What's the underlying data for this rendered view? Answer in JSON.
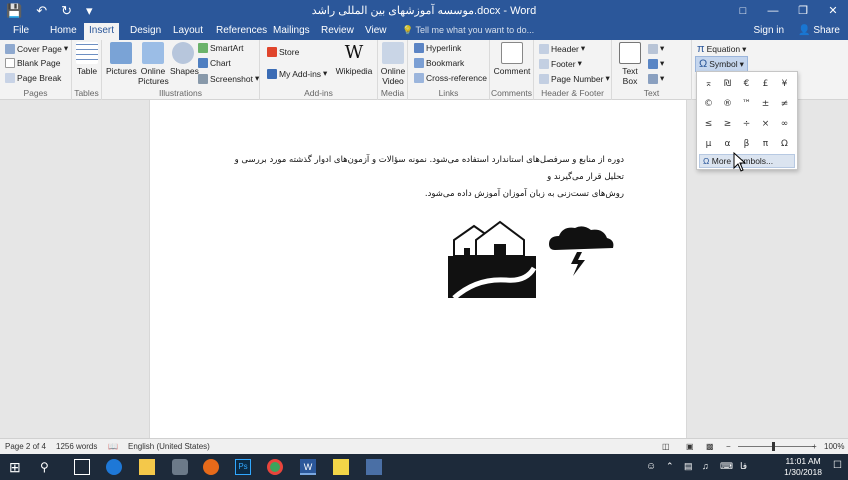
{
  "titlebar": {
    "title": "موسسه آموزشهای بین المللی راشد.docx - Word",
    "save_icon": "save-icon",
    "undo_icon": "undo-icon",
    "redo_icon": "redo-icon",
    "customize_icon": "customize-qat-icon"
  },
  "tabs": [
    "File",
    "Home",
    "Insert",
    "Design",
    "Layout",
    "References",
    "Mailings",
    "Review",
    "View"
  ],
  "tell_me": "Tell me what you want to do...",
  "account": {
    "signin": "Sign in",
    "share": "Share"
  },
  "ribbon": {
    "pages": {
      "label": "Pages",
      "cover": "Cover Page",
      "blank": "Blank Page",
      "break": "Page Break"
    },
    "tables": {
      "label": "Tables",
      "table": "Table"
    },
    "illustrations": {
      "label": "Illustrations",
      "pictures": "Pictures",
      "online_pictures": "Online Pictures",
      "shapes": "Shapes",
      "smartart": "SmartArt",
      "chart": "Chart",
      "screenshot": "Screenshot"
    },
    "addins": {
      "label": "Add-ins",
      "store": "Store",
      "my_addins": "My Add-ins",
      "wikipedia": "Wikipedia"
    },
    "media": {
      "label": "Media",
      "online_video": "Online Video"
    },
    "links": {
      "label": "Links",
      "hyperlink": "Hyperlink",
      "bookmark": "Bookmark",
      "cross_ref": "Cross-reference"
    },
    "comments": {
      "label": "Comments",
      "comment": "Comment"
    },
    "header_footer": {
      "label": "Header & Footer",
      "header": "Header",
      "footer": "Footer",
      "page_number": "Page Number"
    },
    "text": {
      "label": "Text",
      "text_box": "Text Box"
    },
    "symbols": {
      "equation": "Equation",
      "symbol": "Symbol"
    }
  },
  "symbol_dropdown": {
    "symbols": [
      "⌅",
      "₪",
      "€",
      "£",
      "¥",
      "©",
      "®",
      "™",
      "±",
      "≠",
      "≤",
      "≥",
      "÷",
      "×",
      "∞",
      "µ",
      "α",
      "β",
      "π",
      "Ω"
    ],
    "more": "More Symbols..."
  },
  "document": {
    "line1": "دوره از منابع و سرفصل‌های استاندارد استفاده می‌شود. نمونه سؤالات و آزمون‌های ادوار گذشته مورد بررسی و تحلیل قرار می‌گیرند و",
    "line2": "روش‌های تست‌زنی به زبان آموزان آموزش داده می‌شود."
  },
  "status": {
    "page": "Page 2 of 4",
    "words": "1256 words",
    "language": "English (United States)",
    "zoom": "100%"
  },
  "taskbar": {
    "time": "11:01 AM",
    "date": "1/30/2018",
    "lang": "فا"
  }
}
